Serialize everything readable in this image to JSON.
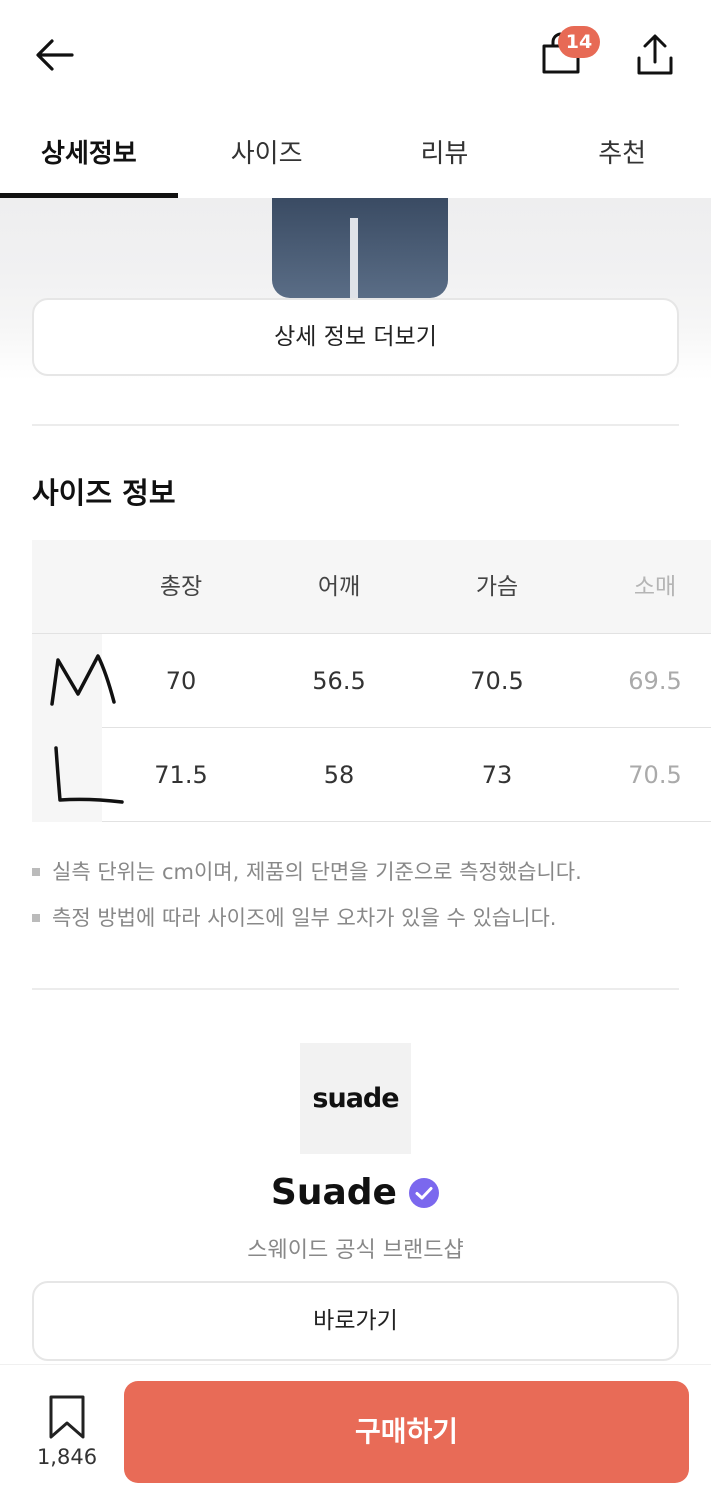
{
  "header": {
    "cart_count": "14",
    "icons": [
      "back-arrow-icon",
      "shopping-bag-icon",
      "share-icon"
    ]
  },
  "tabs": [
    {
      "label": "상세정보",
      "active": true
    },
    {
      "label": "사이즈",
      "active": false
    },
    {
      "label": "리뷰",
      "active": false
    },
    {
      "label": "추천",
      "active": false
    }
  ],
  "details": {
    "more_label": "상세 정보 더보기"
  },
  "size_info": {
    "title": "사이즈 정보",
    "columns": [
      "총장",
      "어깨",
      "가슴",
      "소매"
    ],
    "rows": [
      {
        "size": "M",
        "values": [
          "70",
          "56.5",
          "70.5",
          "69.5"
        ]
      },
      {
        "size": "L",
        "values": [
          "71.5",
          "58",
          "73",
          "70.5"
        ]
      }
    ],
    "notes": [
      "실측 단위는 cm이며, 제품의 단면을 기준으로 측정했습니다.",
      "측정 방법에 따라 사이즈에 일부 오차가 있을 수 있습니다."
    ]
  },
  "brand": {
    "logo_text": "suade",
    "name": "Suade",
    "verified": true,
    "subtitle": "스웨이드 공식 브랜드샵",
    "goto_label": "바로가기"
  },
  "bottom_bar": {
    "bookmark_count": "1,846",
    "buy_label": "구매하기"
  },
  "colors": {
    "accent": "#e86b57",
    "badge": "#e76a55",
    "verified": "#7b68ee"
  }
}
